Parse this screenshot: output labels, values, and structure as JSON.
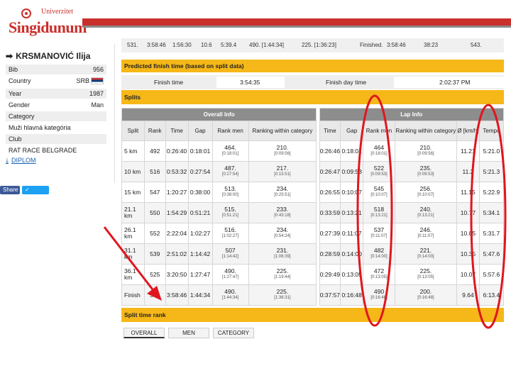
{
  "logo": {
    "small": "Univerzitet",
    "big": "Singidunum"
  },
  "runner": {
    "name": "KRSMANOVIĆ Ilija"
  },
  "info": [
    {
      "k": "Bib",
      "v": "956"
    },
    {
      "k": "Country",
      "v": "SRB"
    },
    {
      "k": "Year",
      "v": "1987"
    },
    {
      "k": "Gender",
      "v": "Man"
    },
    {
      "k": "Category",
      "v": ""
    },
    {
      "k": "Muži hlavná kategória",
      "v": ""
    },
    {
      "k": "Club",
      "v": ""
    },
    {
      "k": "RAT RACE BELGRADE",
      "v": ""
    }
  ],
  "diploma": "DIPLOM",
  "share": {
    "fb": "Share",
    "tw": "Tweet"
  },
  "prev_row": [
    "531.",
    "3:58:46",
    "1:56:30",
    "10.6",
    "5:39.4",
    "490. [1:44:34]",
    "225. [1:36:23]",
    "Finished.",
    "3:58:46",
    "38:23",
    "543."
  ],
  "predicted": {
    "title": "Predicted finish time (based on split data)",
    "finish_label": "Finish time",
    "finish_value": "3:54:35",
    "day_label": "Finish day time",
    "day_value": "2:02:37 PM"
  },
  "splits_title": "Splits",
  "groups": {
    "overall": "Overall Info",
    "lap": "Lap Info"
  },
  "headers": {
    "split": "Split",
    "rank": "Rank",
    "time": "Time",
    "gap": "Gap",
    "rank_men": "Rank men",
    "ranking_cat": "Ranking within category",
    "lap_time": "Time",
    "lap_gap": "Gap",
    "lap_rank_men": "Rank men",
    "lap_ranking_cat": "Ranking within category",
    "speed": "Ø [km/h]",
    "tempo": "Tempo"
  },
  "rows": [
    {
      "split": "5 km",
      "rank": "492",
      "time": "0:26:40",
      "gap": "0:18:01",
      "rank_men": "464.",
      "rank_men_sub": "[0:18:01]",
      "cat": "210.",
      "cat_sub": "[0:09:56]",
      "lap_time": "0:26:46",
      "lap_gap": "0:18:01",
      "lap_rank_men": "464",
      "lap_rank_men_sub": "[0:18:01]",
      "lap_cat": "210.",
      "lap_cat_sub": "[0:09:56]",
      "speed": "11.21",
      "tempo": "5:21.0"
    },
    {
      "split": "10 km",
      "rank": "516",
      "time": "0:53:32",
      "gap": "0:27:54",
      "rank_men": "487.",
      "rank_men_sub": "[0:27:54]",
      "cat": "217.",
      "cat_sub": "[0:15:51]",
      "lap_time": "0:26:47",
      "lap_gap": "0:09:53",
      "lap_rank_men": "522",
      "lap_rank_men_sub": "[0:09:53]",
      "lap_cat": "235.",
      "lap_cat_sub": "[0:09:53]",
      "speed": "11.2",
      "tempo": "5:21.3"
    },
    {
      "split": "15 km",
      "rank": "547",
      "time": "1:20:27",
      "gap": "0:38:00",
      "rank_men": "513.",
      "rank_men_sub": "[0:38:00]",
      "cat": "234.",
      "cat_sub": "[0:25:51]",
      "lap_time": "0:26:55",
      "lap_gap": "0:10:07",
      "lap_rank_men": "545",
      "lap_rank_men_sub": "[0:10:07]",
      "lap_cat": "256.",
      "lap_cat_sub": "[0:10:07]",
      "speed": "11.15",
      "tempo": "5:22.9"
    },
    {
      "split": "21.1 km",
      "rank": "550",
      "time": "1:54:29",
      "gap": "0:51:21",
      "rank_men": "515.",
      "rank_men_sub": "[0:51:21]",
      "cat": "233.",
      "cat_sub": "[0:43:18]",
      "lap_time": "0:33:59",
      "lap_gap": "0:13:21",
      "lap_rank_men": "518",
      "lap_rank_men_sub": "[0:13:21]",
      "lap_cat": "240.",
      "lap_cat_sub": "[0:13:21]",
      "speed": "10.77",
      "tempo": "5:34.1"
    },
    {
      "split": "26.1 km",
      "rank": "552",
      "time": "2:22:04",
      "gap": "1:02:27",
      "rank_men": "516.",
      "rank_men_sub": "[1:02:27]",
      "cat": "234.",
      "cat_sub": "[0:54:24]",
      "lap_time": "0:27:39",
      "lap_gap": "0:11:07",
      "lap_rank_men": "537",
      "lap_rank_men_sub": "[0:11:07]",
      "lap_cat": "246.",
      "lap_cat_sub": "[0:11:07]",
      "speed": "10.85",
      "tempo": "5:31.7"
    },
    {
      "split": "31.1 km",
      "rank": "539",
      "time": "2:51:02",
      "gap": "1:14:42",
      "rank_men": "507",
      "rank_men_sub": "[1:14:42]",
      "cat": "231.",
      "cat_sub": "[1:06:39]",
      "lap_time": "0:28:59",
      "lap_gap": "0:14:00",
      "lap_rank_men": "482",
      "lap_rank_men_sub": "[0:14:00]",
      "lap_cat": "221.",
      "lap_cat_sub": "[0:14:00]",
      "speed": "10.35",
      "tempo": "5:47.6"
    },
    {
      "split": "36.1 km",
      "rank": "525",
      "time": "3:20:50",
      "gap": "1:27:47",
      "rank_men": "490.",
      "rank_men_sub": "[1:27:47]",
      "cat": "225.",
      "cat_sub": "[1:19:44]",
      "lap_time": "0:29:49",
      "lap_gap": "0:13:05",
      "lap_rank_men": "472",
      "lap_rank_men_sub": "[0:13:05]",
      "lap_cat": "225.",
      "lap_cat_sub": "[0:13:05]",
      "speed": "10.07",
      "tempo": "5:57.6"
    },
    {
      "split": "Finish",
      "rank": "531",
      "time": "3:58:46",
      "gap": "1:44:34",
      "rank_men": "490.",
      "rank_men_sub": "[1:44:34]",
      "cat": "225.",
      "cat_sub": "[1:36:31]",
      "lap_time": "0:37:57",
      "lap_gap": "0:16:48",
      "lap_rank_men": "490",
      "lap_rank_men_sub": "[0:16:48]",
      "lap_cat": "200.",
      "lap_cat_sub": "[0:16:48]",
      "speed": "9.64",
      "tempo": "6:13.4"
    }
  ],
  "split_rank_title": "Split time rank",
  "tabs": [
    "OVERALL",
    "MEN",
    "CATEGORY"
  ],
  "colors": {
    "accent_red": "#c9302c",
    "annotation_red": "#e0161e",
    "yellow": "#f5b818"
  }
}
